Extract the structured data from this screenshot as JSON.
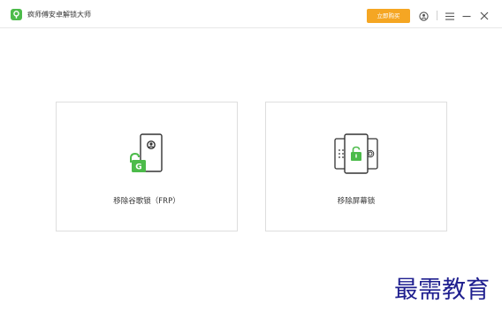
{
  "app": {
    "title": "疯师傅安卓解锁大师",
    "buy_label": "立即购买"
  },
  "cards": [
    {
      "label": "移除谷歌锁（FRP）"
    },
    {
      "label": "移除屏幕锁"
    }
  ],
  "watermark": "最需教育",
  "colors": {
    "accent_green": "#4cbb4a",
    "buy_orange": "#f5a623",
    "watermark_blue": "#1f1f8f"
  },
  "icons": [
    "app-logo",
    "account-icon",
    "menu-icon",
    "minimize-icon",
    "close-icon",
    "google-lock-phone-icon",
    "screen-lock-phones-icon"
  ]
}
